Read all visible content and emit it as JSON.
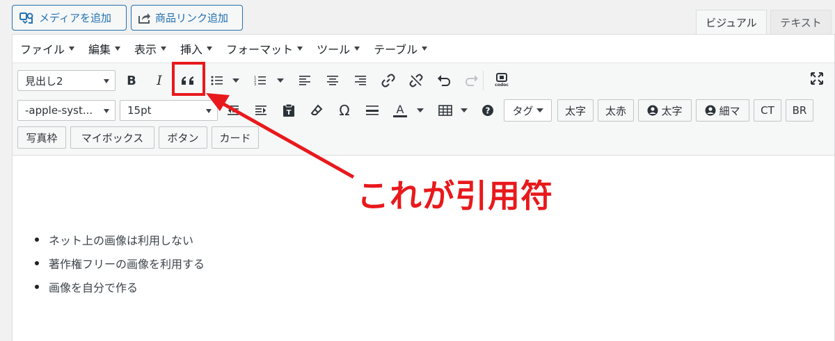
{
  "top_buttons": {
    "add_media": "メディアを追加",
    "add_product_link": "商品リンク追加"
  },
  "tabs": {
    "visual": "ビジュアル",
    "text": "テキスト"
  },
  "menubar": [
    "ファイル",
    "編集",
    "表示",
    "挿入",
    "フォーマット",
    "ツール",
    "テーブル"
  ],
  "toolbar": {
    "format_select": "見出し2",
    "font_family_select": "-apple-syst...",
    "font_size_select": "15pt",
    "tag_select": "タグ",
    "codoc_label": "codoc",
    "buttons_row2": [
      "太字",
      "太赤",
      "太字",
      "細マ",
      "CT",
      "BR"
    ],
    "buttons_row3": [
      "写真枠",
      "マイボックス",
      "ボタン",
      "カード"
    ]
  },
  "content": {
    "list_items": [
      "ネット上の画像は利用しない",
      "著作権フリーの画像を利用する",
      "画像を自分で作る"
    ]
  },
  "annotation": {
    "text": "これが引用符",
    "color": "#e8191c"
  },
  "colors": {
    "accent": "#2271b1",
    "annotation_red": "#e8191c"
  }
}
